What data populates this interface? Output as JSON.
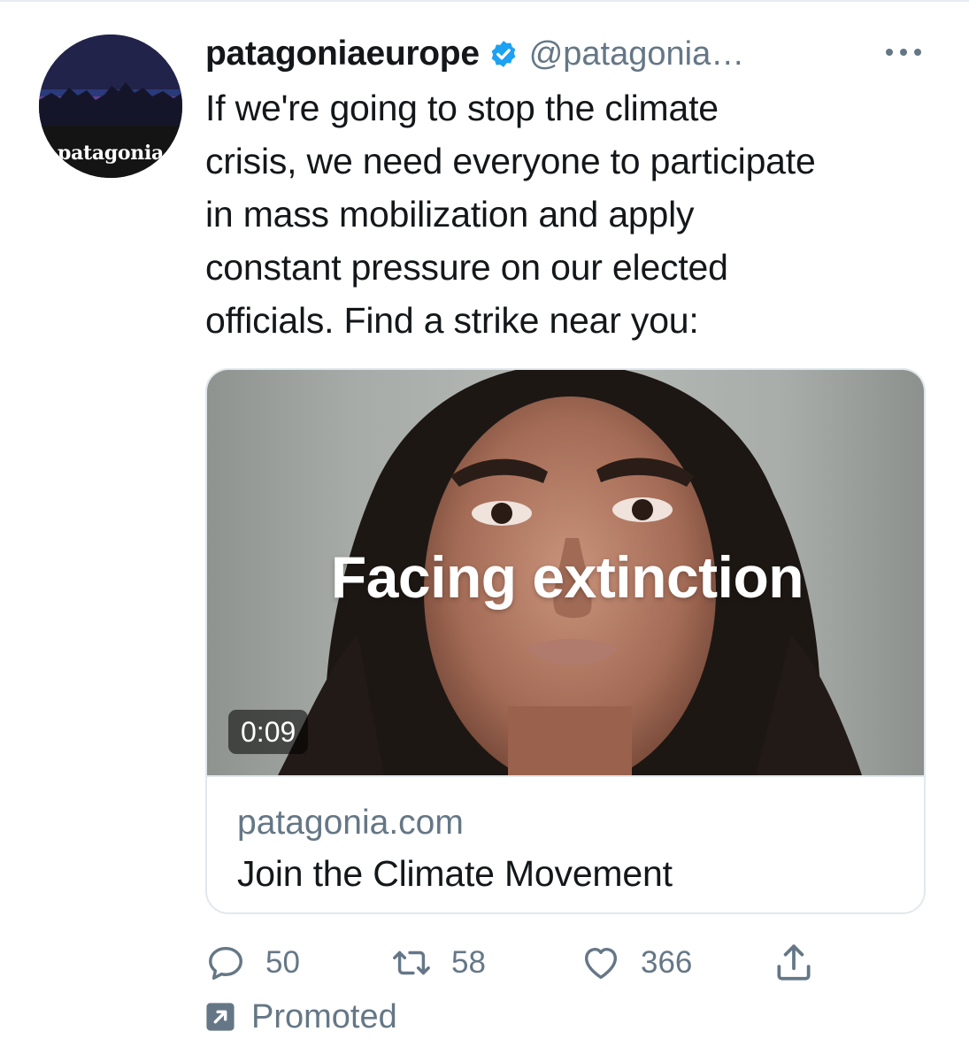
{
  "tweet": {
    "display_name": "patagoniaeurope",
    "handle": "@patagonia…",
    "verified": true,
    "avatar_wordmark": "patagonia",
    "text": "If we're going to stop the climate\ncrisis, we need everyone to participate\nin mass mobilization and apply\nconstant pressure on our elected\nofficials. Find a strike near you:"
  },
  "card": {
    "overlay_text": "Facing extinction",
    "duration": "0:09",
    "domain": "patagonia.com",
    "title": "Join the Climate Movement"
  },
  "actions": {
    "replies": "50",
    "retweets": "58",
    "likes": "366"
  },
  "promoted_label": "Promoted",
  "icons": [
    "verified-icon",
    "more-icon",
    "reply-icon",
    "retweet-icon",
    "like-icon",
    "share-icon",
    "promoted-icon"
  ],
  "colors": {
    "text": "#14171a",
    "secondary": "#657786",
    "verified": "#1da1f2",
    "border": "#e1e8ed",
    "avatar_bg": "#1c1b2e"
  }
}
